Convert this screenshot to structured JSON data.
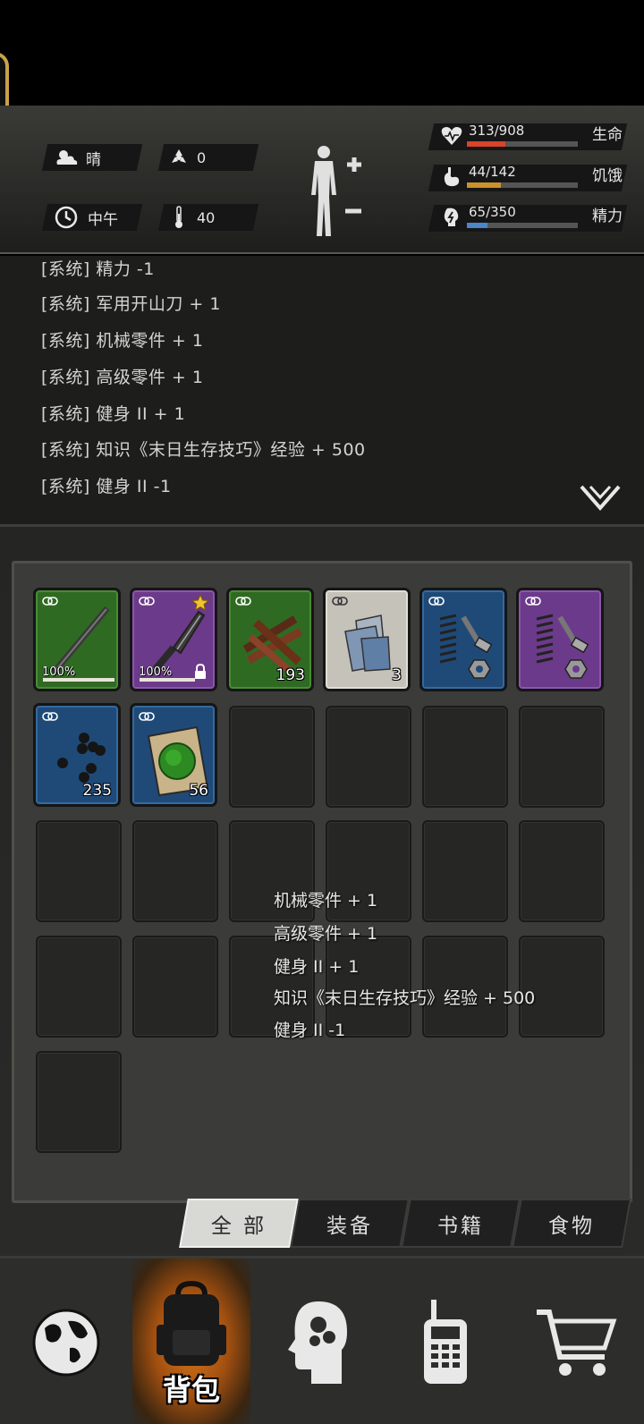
{
  "header": {
    "weather": "晴",
    "radiation": "0",
    "time_of_day": "中午",
    "temperature": "40",
    "stats": [
      {
        "value": "313/908",
        "label": "生命",
        "fraction": 0.345,
        "color": "#d9442b",
        "icon": "heart-icon"
      },
      {
        "value": "44/142",
        "label": "饥饿",
        "fraction": 0.31,
        "color": "#c9932c",
        "icon": "stomach-icon"
      },
      {
        "value": "65/350",
        "label": "精力",
        "fraction": 0.186,
        "color": "#4a86c8",
        "icon": "energy-icon"
      }
    ]
  },
  "log": {
    "lines": [
      "[系统] 精力 -1",
      "[系统] 军用开山刀 + 1",
      "[系统] 机械零件 + 1",
      "[系统] 高级零件 + 1",
      "[系统] 健身 II  + 1",
      "[系统] 知识《末日生存技巧》经验 + 500",
      "[系统] 健身 II  -1"
    ]
  },
  "inventory": {
    "items": [
      {
        "icon": "stick-icon",
        "rarity": "green",
        "durability": "100%",
        "durability_fraction": 1.0
      },
      {
        "icon": "machete-icon",
        "rarity": "purple",
        "durability": "100%",
        "durability_fraction": 1.0,
        "starred": true,
        "locked": true
      },
      {
        "icon": "wood-planks-icon",
        "rarity": "green",
        "count": "193"
      },
      {
        "icon": "cloth-icon",
        "rarity": "gray",
        "count": "3"
      },
      {
        "icon": "mechanical-parts-icon",
        "rarity": "blue"
      },
      {
        "icon": "advanced-parts-icon",
        "rarity": "purple"
      },
      {
        "icon": "ammo-pellets-icon",
        "rarity": "blue",
        "count": "235"
      },
      {
        "icon": "herb-icon",
        "rarity": "blue",
        "count": "56"
      }
    ],
    "floating_messages": [
      "机械零件 + 1",
      "高级零件 + 1",
      "健身 II  + 1",
      "知识《末日生存技巧》经验 + 500",
      "健身 II  -1"
    ]
  },
  "tabs": [
    {
      "label": "全 部",
      "active": true
    },
    {
      "label": "装备",
      "active": false
    },
    {
      "label": "书籍",
      "active": false
    },
    {
      "label": "食物",
      "active": false
    }
  ],
  "nav": {
    "items": [
      {
        "icon": "globe-icon",
        "label": ""
      },
      {
        "icon": "backpack-icon",
        "label": "背包",
        "active": true
      },
      {
        "icon": "skills-head-icon",
        "label": ""
      },
      {
        "icon": "walkie-talkie-icon",
        "label": ""
      },
      {
        "icon": "shopping-cart-icon",
        "label": ""
      }
    ]
  }
}
